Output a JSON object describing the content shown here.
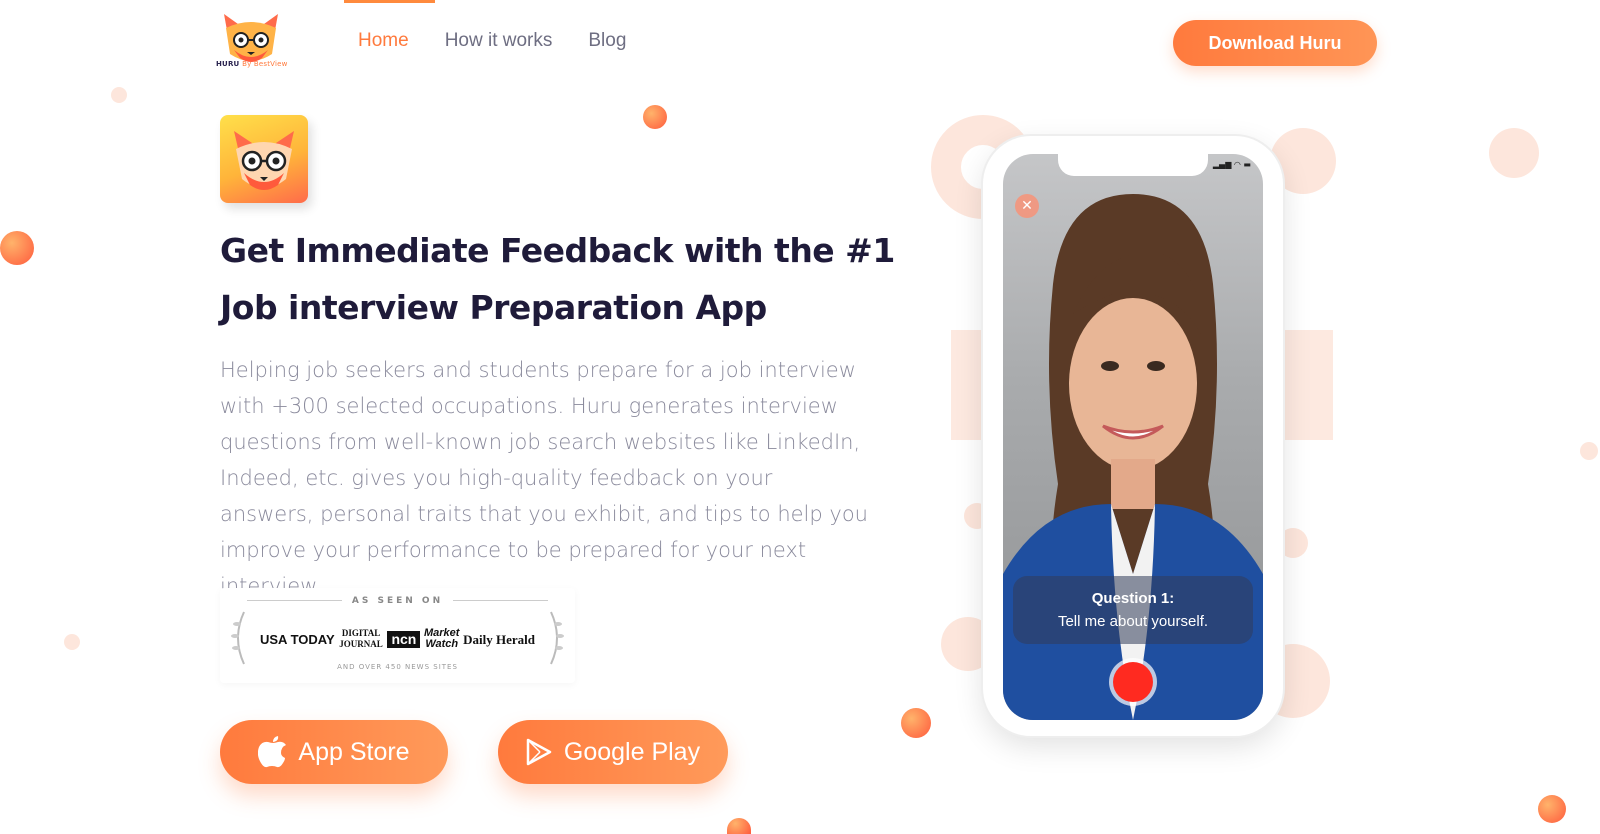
{
  "brand": {
    "logo_text": "HURU",
    "logo_by": "By BestView"
  },
  "nav": {
    "items": [
      {
        "label": "Home",
        "active": true
      },
      {
        "label": "How it works",
        "active": false
      },
      {
        "label": "Blog",
        "active": false
      }
    ],
    "cta_label": "Download Huru"
  },
  "hero": {
    "headline": "Get Immediate Feedback with the #1 Job interview Preparation App",
    "description": "Helping job seekers and students prepare for a job interview with +300 selected occupations. Huru generates interview questions from well-known job search websites like LinkedIn, Indeed, etc. gives you high-quality feedback on your answers, personal traits that you exhibit, and tips to help you improve your performance to be prepared for your next interview."
  },
  "press": {
    "top_label": "AS SEEN ON",
    "logos": [
      "USA TODAY",
      "DIGITAL JOURNAL",
      "ncn",
      "Market Watch",
      "Daily Herald"
    ],
    "bottom_label": "AND OVER 450 NEWS SITES"
  },
  "stores": {
    "app_store_label": "App Store",
    "google_play_label": "Google Play"
  },
  "phone": {
    "question_title": "Question 1:",
    "question_text": "Tell me about yourself."
  },
  "colors": {
    "accent": "#ff7a3d",
    "heading": "#1f1b3a",
    "body": "#8a8a9c"
  }
}
